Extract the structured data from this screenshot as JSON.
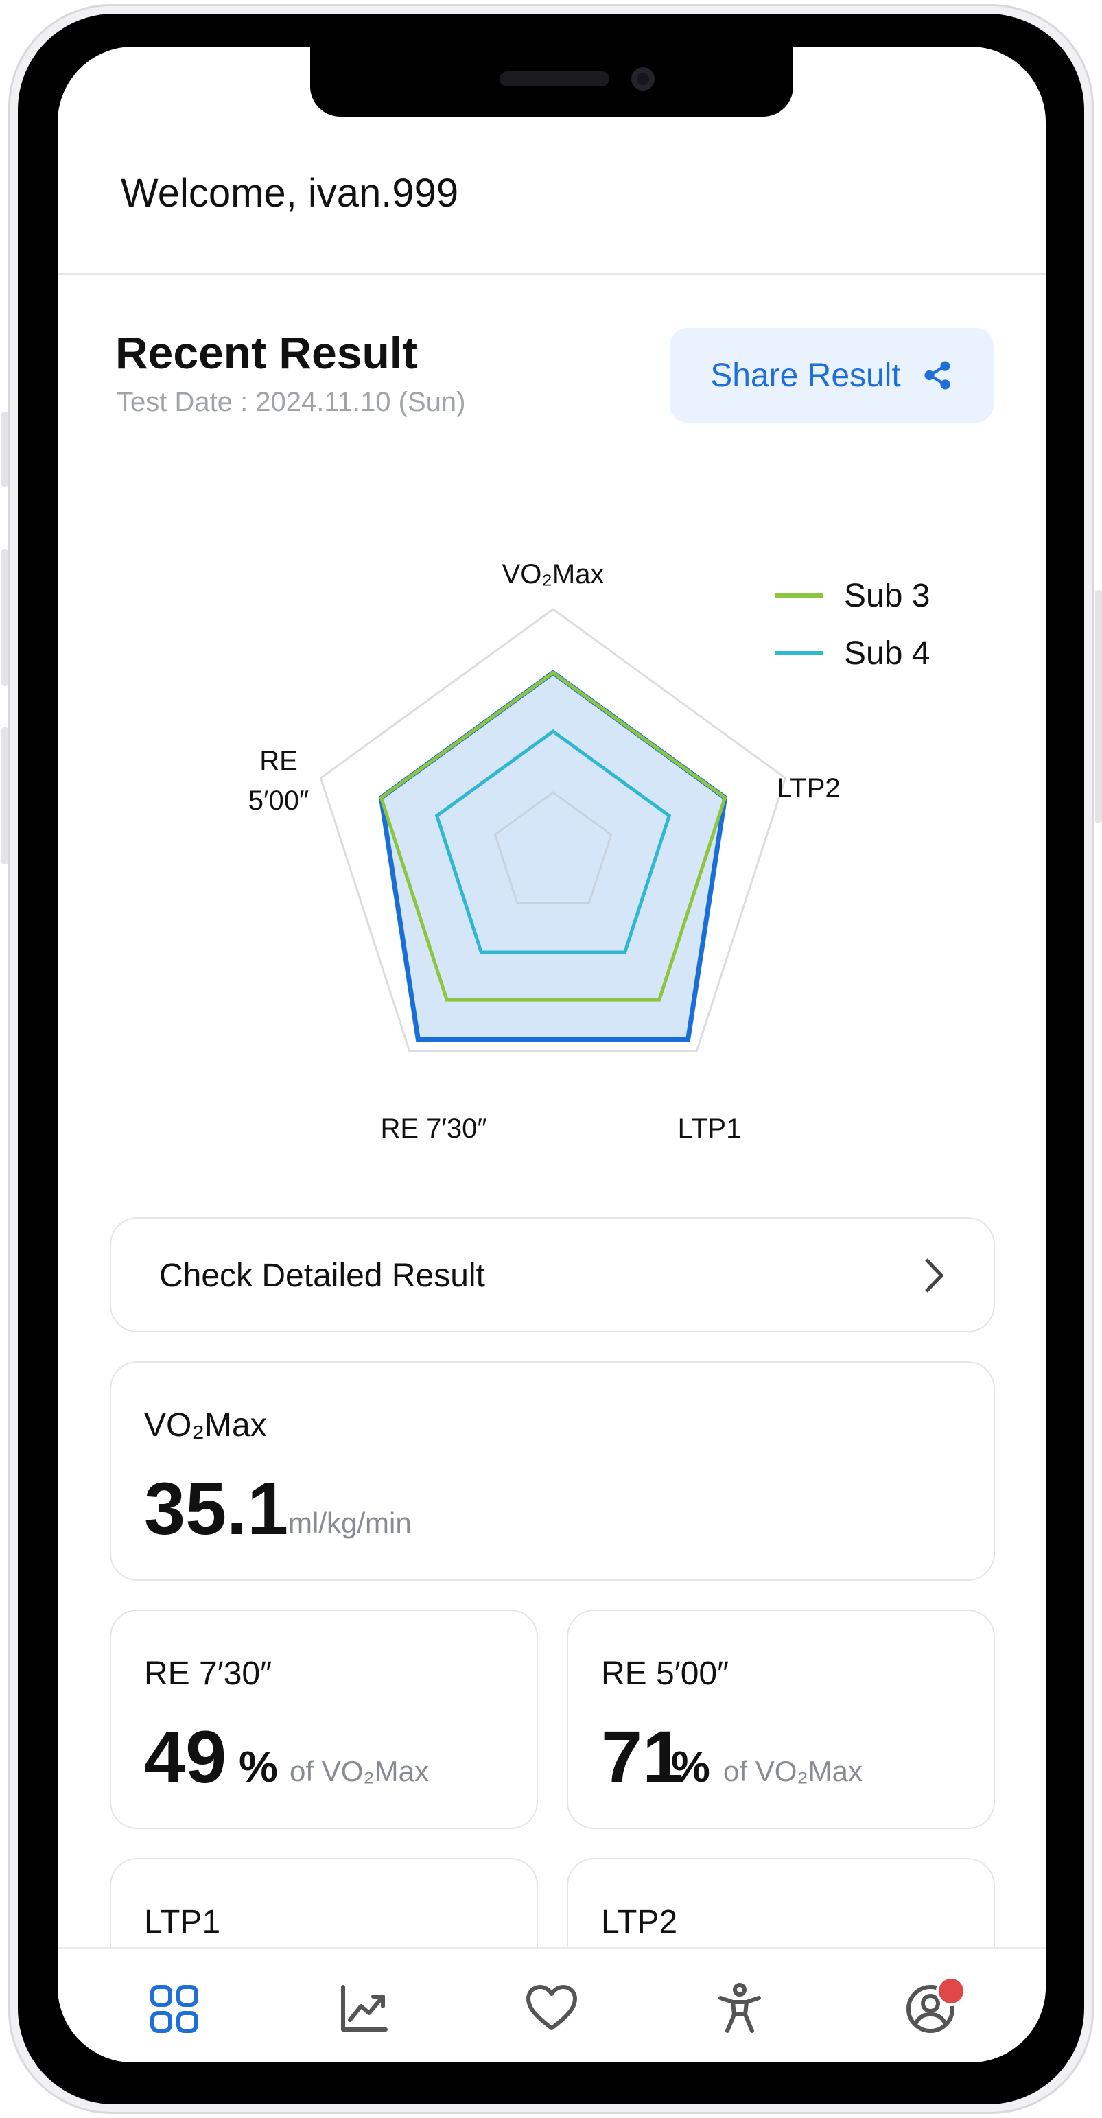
{
  "header": {
    "welcome_prefix": "Welcome,",
    "username": "ivan.999"
  },
  "result": {
    "title": "Recent Result",
    "test_date": "Test Date : 2024.11.10 (Sun)",
    "share_label": "Share Result"
  },
  "chart_data": {
    "type": "radar",
    "axes": [
      "VO₂Max",
      "LTP2",
      "LTP1",
      "RE 7′30″",
      "RE 5′00″"
    ],
    "axis_label_lines": [
      [
        "VO₂Max"
      ],
      [
        "LTP2"
      ],
      [
        "LTP1"
      ],
      [
        "RE 7′30″"
      ],
      [
        "RE",
        "5′00″"
      ]
    ],
    "range": [
      0,
      1
    ],
    "grid_levels": [
      0.25,
      1.0
    ],
    "series": [
      {
        "name": "Sub 3",
        "color": "#8cc63e",
        "values": [
          0.74,
          0.74,
          0.74,
          0.74,
          0.74
        ]
      },
      {
        "name": "Sub 4",
        "color": "#2fb8d0",
        "values": [
          0.5,
          0.5,
          0.5,
          0.5,
          0.5
        ]
      },
      {
        "name": "",
        "color": "#1a6ed8",
        "fill": "#cfe2f8",
        "values": [
          0.74,
          0.74,
          0.94,
          0.94,
          0.74
        ]
      }
    ],
    "legend": "top-right"
  },
  "detail": {
    "label": "Check Detailed Result"
  },
  "metrics": {
    "vo2": {
      "label": "VO₂Max",
      "value": "35.1",
      "unit": "ml/kg/min"
    },
    "re730": {
      "label": "RE 7′30″",
      "value": "49",
      "pct": "%",
      "unit": "of VO₂Max"
    },
    "re500": {
      "label": "RE 5′00″",
      "value": "71",
      "pct": "%",
      "unit": "of VO₂Max"
    },
    "ltp1": {
      "label": "LTP1"
    },
    "ltp2": {
      "label": "LTP2"
    }
  },
  "colors": {
    "accent": "#1f6fd8",
    "sub3": "#8cc63e",
    "sub4": "#2fb8d0",
    "badge": "#e04848"
  },
  "tabs": [
    {
      "icon": "dashboard-grid-icon",
      "active": true
    },
    {
      "icon": "trend-chart-icon",
      "active": false
    },
    {
      "icon": "heart-icon",
      "active": false
    },
    {
      "icon": "person-stretch-icon",
      "active": false
    },
    {
      "icon": "profile-icon",
      "active": false,
      "badge": true
    }
  ]
}
